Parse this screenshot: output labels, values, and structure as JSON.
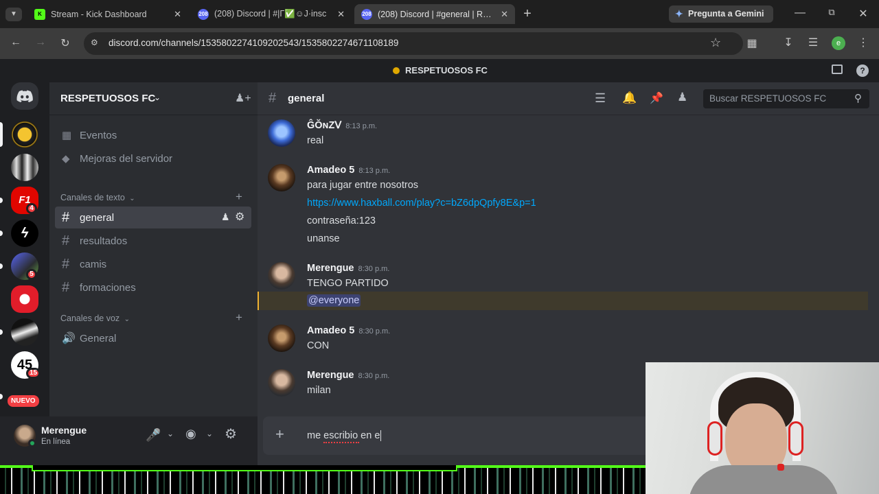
{
  "browser": {
    "tabs": [
      {
        "title": "Stream - Kick Dashboard",
        "favicon": "kick-logo-icon"
      },
      {
        "title": "(208) Discord | #|Γ✅☺J·insc",
        "favicon": "discord-icon",
        "badge": "208"
      },
      {
        "title": "(208) Discord | #general | RESPE",
        "favicon": "discord-icon",
        "badge": "208"
      }
    ],
    "new_tab": "+",
    "gemini_label": "Pregunta a Gemini",
    "url": "discord.com/channels/1535802274109202543/1535802274671108189",
    "profile_initial": "e"
  },
  "discord": {
    "server_title": "RESPETUOSOS FC",
    "server_name": "RESPETUOSOS FC",
    "guild_badges": [
      "4",
      "5",
      "15"
    ],
    "nuevo_label": "NUEVO",
    "sidebar_items": [
      {
        "label": "Eventos",
        "icon": "calendar-icon"
      },
      {
        "label": "Mejoras del servidor",
        "icon": "boost-icon"
      }
    ],
    "text_category": "Canales de texto",
    "text_channels": [
      "general",
      "resultados",
      "camis",
      "formaciones"
    ],
    "voice_category": "Canales de voz",
    "voice_channels": [
      "General"
    ],
    "user": {
      "name": "Merengue",
      "status": "En línea"
    },
    "channel_header": {
      "name": "general",
      "search_placeholder": "Buscar RESPETUOSOS FC"
    },
    "messages": [
      {
        "author": "ĜŎɴΖᐯ",
        "time": "8:13 p.m.",
        "lines": [
          "real"
        ]
      },
      {
        "author": "Amadeo 5",
        "time": "8:13 p.m.",
        "lines": [
          "para jugar entre nosotros",
          "https://www.haxball.com/play?c=bZ6dpQpfy8E&p=1",
          "contraseña:123",
          "unanse"
        ]
      },
      {
        "author": "Merengue",
        "time": "8:30 p.m.",
        "lines": [
          "TENGO PARTIDO",
          "@everyone"
        ]
      },
      {
        "author": "Amadeo 5",
        "time": "8:30 p.m.",
        "lines": [
          "CON"
        ]
      },
      {
        "author": "Merengue",
        "time": "8:30 p.m.",
        "lines": [
          "milan"
        ]
      }
    ],
    "composer_text": "me escribio en e"
  },
  "colors": {
    "accent": "#5865f2",
    "link": "#00a8fc",
    "mention": "#f0b232",
    "online": "#23a55a",
    "badge": "#f23f43"
  }
}
